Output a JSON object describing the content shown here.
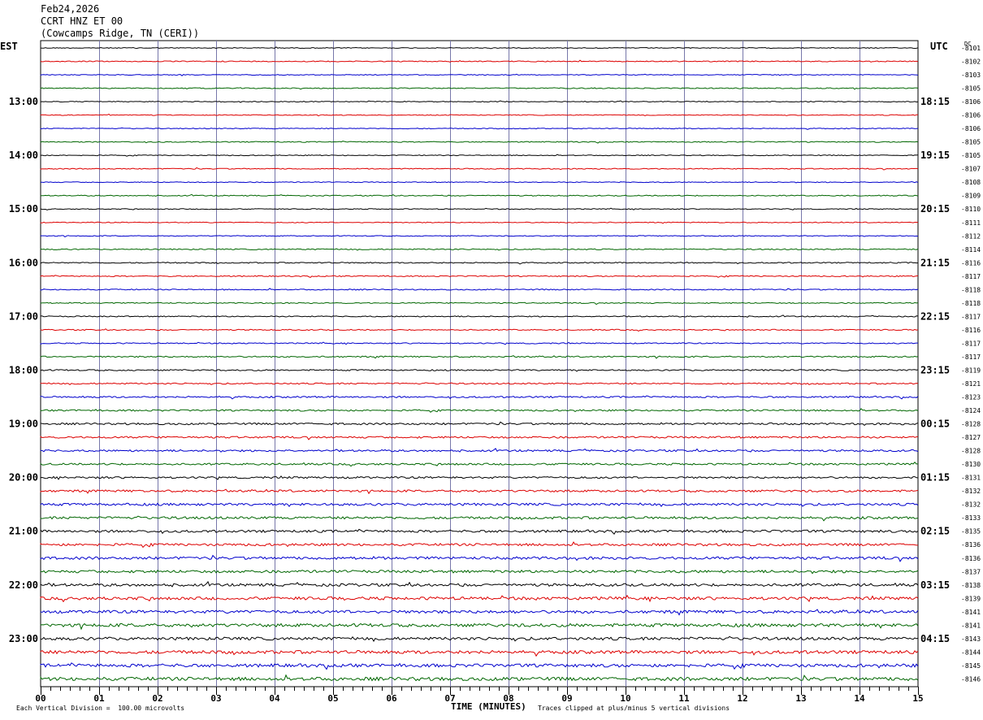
{
  "header": {
    "date": "Feb24,2026",
    "station": "CCRT HNZ ET 00",
    "location": "(Cowcamps Ridge, TN (CERI))"
  },
  "left_tz": "EST",
  "right_tz": "UTC",
  "dc_label": "DC",
  "footer": {
    "scale_note": "Each Vertical Division =  100.00 microvolts",
    "clip_note": "Traces clipped at plus/minus 5 vertical divisions"
  },
  "colors": {
    "trace_cycle": [
      "#000000",
      "#dd0000",
      "#0000cc",
      "#006600"
    ],
    "gridline": "#7777aa"
  },
  "chart_data": {
    "type": "line",
    "title": "",
    "xlabel": "TIME (MINUTES)",
    "xlim": [
      0,
      15
    ],
    "x_ticks": [
      "00",
      "01",
      "02",
      "03",
      "04",
      "05",
      "06",
      "07",
      "08",
      "09",
      "10",
      "11",
      "12",
      "13",
      "14",
      "15"
    ],
    "left_hour_labels": [
      "13:00",
      "14:00",
      "15:00",
      "16:00",
      "17:00",
      "18:00",
      "19:00",
      "20:00",
      "21:00",
      "22:00",
      "23:00"
    ],
    "right_hour_labels": [
      "18:15",
      "19:15",
      "20:15",
      "21:15",
      "22:15",
      "23:15",
      "00:15",
      "01:15",
      "02:15",
      "03:15",
      "04:15"
    ],
    "first_hour_label_row": 4,
    "dc_offsets": [
      "-8101",
      "-8102",
      "-8103",
      "-8105",
      "-8106",
      "-8106",
      "-8106",
      "-8105",
      "-8105",
      "-8107",
      "-8108",
      "-8109",
      "-8110",
      "-8111",
      "-8112",
      "-8114",
      "-8116",
      "-8117",
      "-8118",
      "-8118",
      "-8117",
      "-8116",
      "-8117",
      "-8117",
      "-8119",
      "-8121",
      "-8123",
      "-8124",
      "-8128",
      "-8127",
      "-8128",
      "-8130",
      "-8131",
      "-8132",
      "-8132",
      "-8133",
      "-8135",
      "-8136",
      "-8136",
      "-8137",
      "-8138",
      "-8139",
      "-8141",
      "-8141",
      "-8143",
      "-8144",
      "-8145",
      "-8146"
    ],
    "trace_amplitude_divisions": [
      0.15,
      0.18,
      0.15,
      0.18,
      0.15,
      0.15,
      0.15,
      0.18,
      0.15,
      0.18,
      0.15,
      0.18,
      0.15,
      0.15,
      0.15,
      0.2,
      0.2,
      0.2,
      0.2,
      0.2,
      0.2,
      0.2,
      0.2,
      0.25,
      0.25,
      0.25,
      0.3,
      0.3,
      0.35,
      0.35,
      0.35,
      0.35,
      0.35,
      0.4,
      0.45,
      0.45,
      0.45,
      0.45,
      0.5,
      0.5,
      0.5,
      0.55,
      0.55,
      0.6,
      0.55,
      0.6,
      0.6,
      0.65
    ],
    "scale_microvolts_per_division": 100.0,
    "clip_divisions": 5
  }
}
